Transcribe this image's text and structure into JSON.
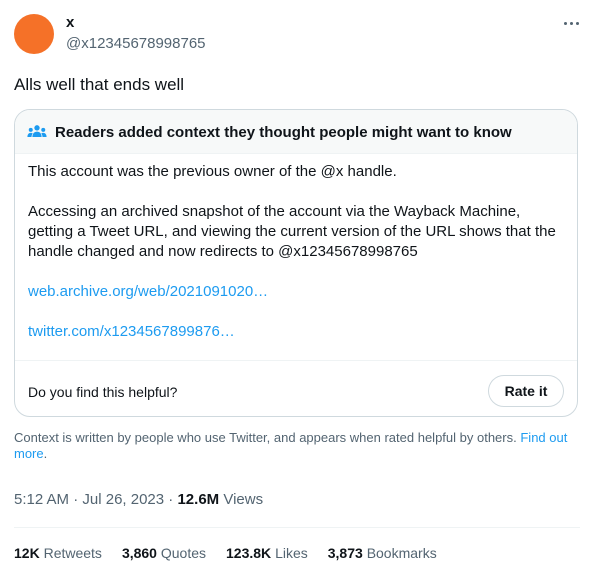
{
  "tweet": {
    "display_name": "x",
    "handle": "@x12345678998765",
    "text": "Alls well that ends well",
    "avatar_color": "#f57128",
    "more_icon": "more-horizontal-icon"
  },
  "note": {
    "icon": "people-icon",
    "title": "Readers added context they thought people might want to know",
    "paragraph_1": "This account was the previous owner of the @x handle.",
    "paragraph_2": "Accessing an archived snapshot of the account via the Wayback Machine, getting a Tweet URL, and viewing the current version of the URL shows that the handle changed and now redirects to @x12345678998765",
    "link_1": "web.archive.org/web/2021091020…",
    "link_2": "twitter.com/x1234567899876…",
    "helpful_question": "Do you find this helpful?",
    "rate_label": "Rate it"
  },
  "context": {
    "text": "Context is written by people who use Twitter, and appears when rated helpful by others.",
    "link": "Find out more",
    "end": "."
  },
  "meta": {
    "time": "5:12 AM",
    "separator": "·",
    "date": "Jul 26, 2023",
    "views_count": "12.6M",
    "views_label": "Views"
  },
  "stats": {
    "retweets_count": "12K",
    "retweets_label": "Retweets",
    "quotes_count": "3,860",
    "quotes_label": "Quotes",
    "likes_count": "123.8K",
    "likes_label": "Likes",
    "bookmarks_count": "3,873",
    "bookmarks_label": "Bookmarks"
  },
  "colors": {
    "accent": "#1d9bf0",
    "secondary_text": "#536471",
    "border": "#cfd9de"
  }
}
